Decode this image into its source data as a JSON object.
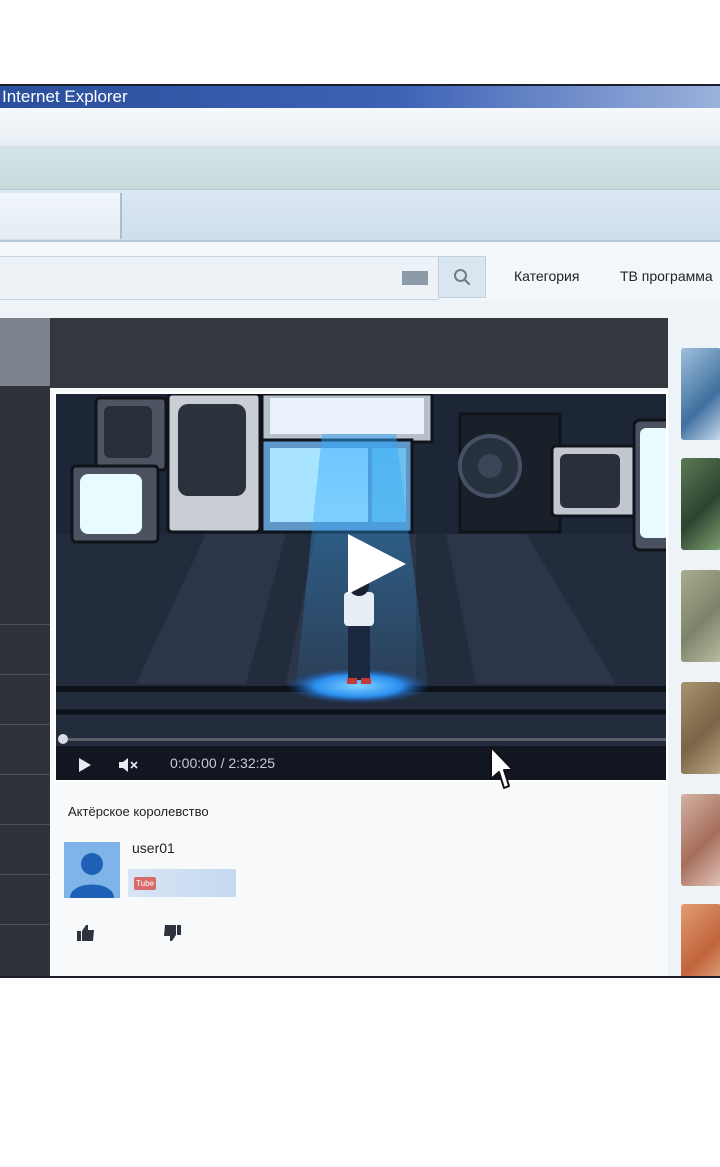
{
  "window": {
    "title": "Internet Explorer"
  },
  "nav": {
    "links": [
      "Категория",
      "ТВ программа"
    ]
  },
  "player": {
    "time": "0:00:00 / 2:32:25",
    "progress": 0
  },
  "video": {
    "title": "Актёрское королевство",
    "uploader": "user01",
    "channel_badge": "Tube"
  },
  "icons": {
    "search": "search-icon",
    "play": "play-icon",
    "mute": "mute-icon",
    "like": "thumbs-up-icon",
    "dislike": "thumbs-down-icon",
    "cursor": "mouse-pointer-icon"
  },
  "colors": {
    "titlebar": "#2a4f9c",
    "spotlight": "#2fa8ff",
    "avatar": "#7fb4e8"
  }
}
